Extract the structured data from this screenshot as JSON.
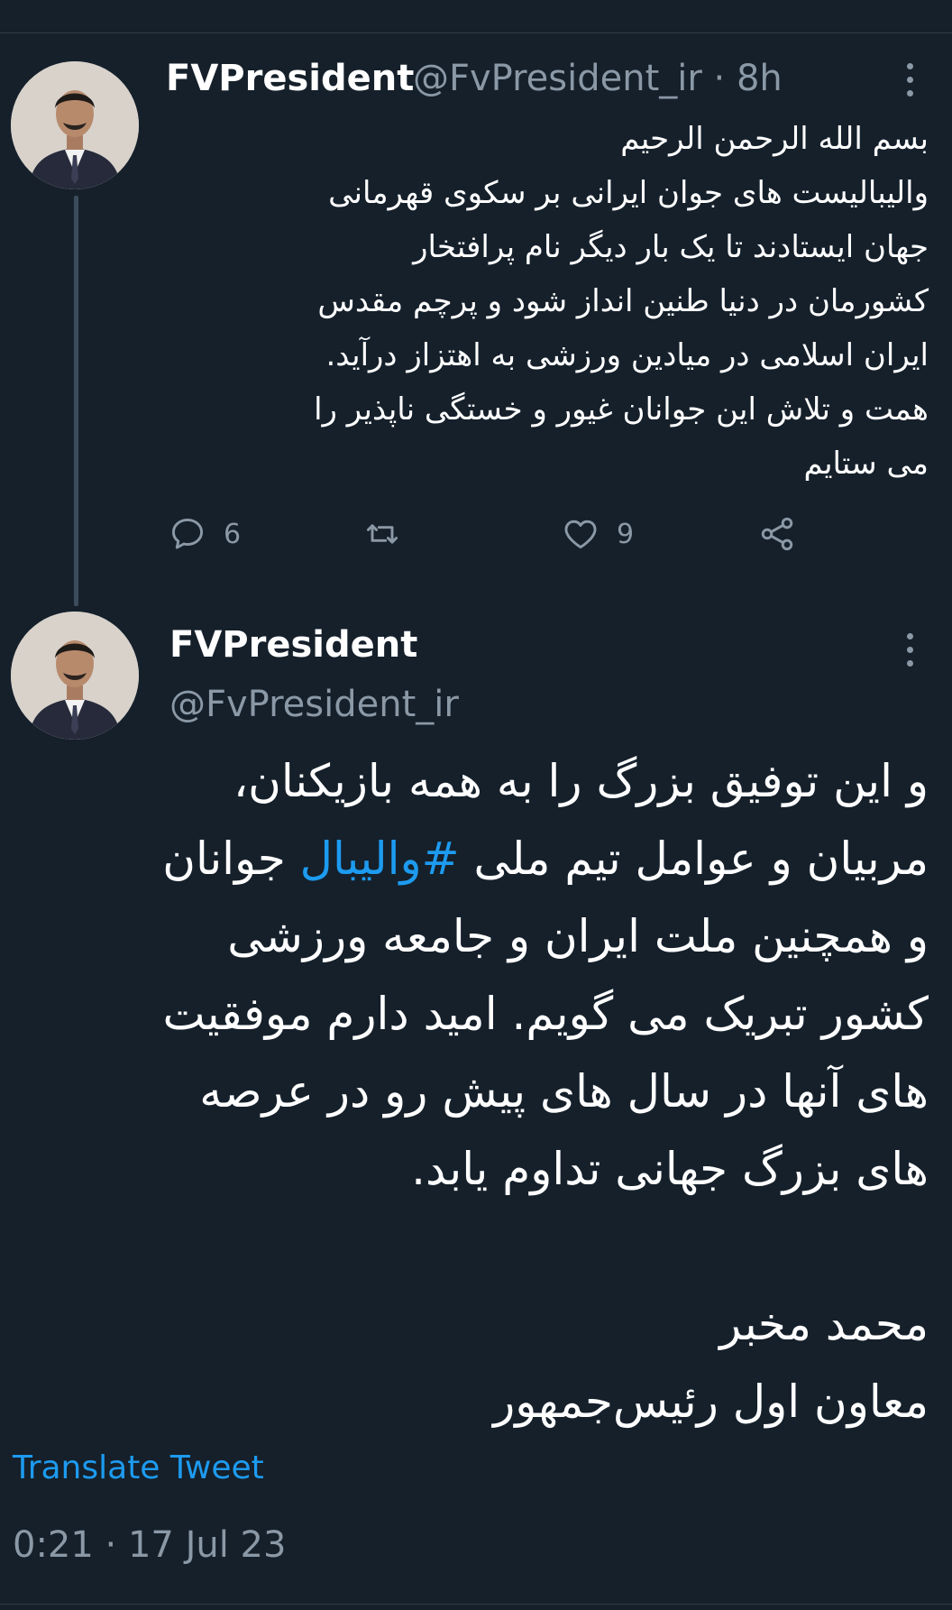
{
  "tweet1": {
    "name": "FVPresident",
    "handle": "@FvPresident_ir",
    "separator": "·",
    "time": "8h",
    "text_lines": [
      "بسم الله الرحمن الرحیم",
      "والیبالیست های جوان ایرانی بر سکوی قهرمانی",
      "جهان ایستادند تا یک بار دیگر نام پرافتخار",
      "کشورمان در دنیا طنین انداز شود و پرچم مقدس",
      "ایران اسلامی در میادین ورزشی به اهتزاز درآید.",
      "همت و تلاش این جوانان غیور و خستگی ناپذیر را",
      "می ستایم"
    ],
    "replies": "6",
    "likes": "9",
    "icons": [
      "reply-icon",
      "retweet-icon",
      "like-icon",
      "share-icon",
      "more-icon"
    ]
  },
  "tweet2": {
    "name": "FVPresident",
    "handle": "@FvPresident_ir",
    "line1": "و این توفیق بزرگ را به همه بازیکنان،",
    "line2_before": "مربیان و عوامل تیم ملی ",
    "hashtag": "#والیبال",
    "line2_after": " جوانان",
    "line3": "و همچنین ملت ایران و جامعه ورزشی",
    "line4": "کشور تبریک می گویم. امید دارم موفقیت",
    "line5": "های آنها در سال های پیش رو در عرصه",
    "line6": "های بزرگ جهانی تداوم یابد.",
    "signature_name": "محمد مخبر",
    "signature_title": "معاون اول رئیس‌جمهور",
    "translate_label": "Translate Tweet",
    "timestamp": "0:21 · 17 Jul 23"
  },
  "colors": {
    "background": "#15202b",
    "text": "#ffffff",
    "secondary": "#8b98a5",
    "accent": "#1d9bf0",
    "thread_line": "#3d4c5c"
  }
}
